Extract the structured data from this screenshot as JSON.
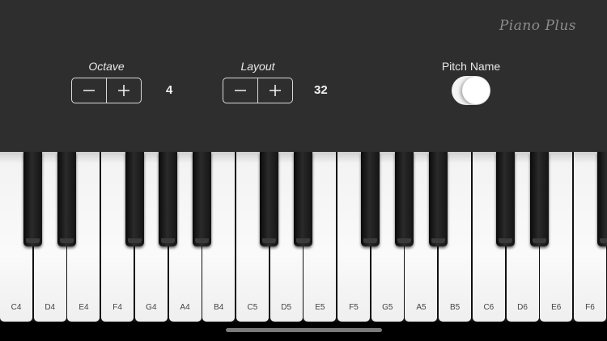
{
  "app": {
    "title": "Piano Plus"
  },
  "octave": {
    "label": "Octave",
    "value": "4"
  },
  "layout": {
    "label": "Layout",
    "value": "32"
  },
  "pitch_name": {
    "label": "Pitch Name",
    "enabled": true
  },
  "keyboard": {
    "white_keys": [
      "C4",
      "D4",
      "E4",
      "F4",
      "G4",
      "A4",
      "B4",
      "C5",
      "D5",
      "E5",
      "F5",
      "G5",
      "A5",
      "B5",
      "C6",
      "D6",
      "E6",
      "F6"
    ],
    "black_keys": [
      "C#4",
      "D#4",
      "F#4",
      "G#4",
      "A#4",
      "C#5",
      "D#5",
      "F#5",
      "G#5",
      "A#5",
      "C#6",
      "D#6",
      "F#6"
    ]
  }
}
